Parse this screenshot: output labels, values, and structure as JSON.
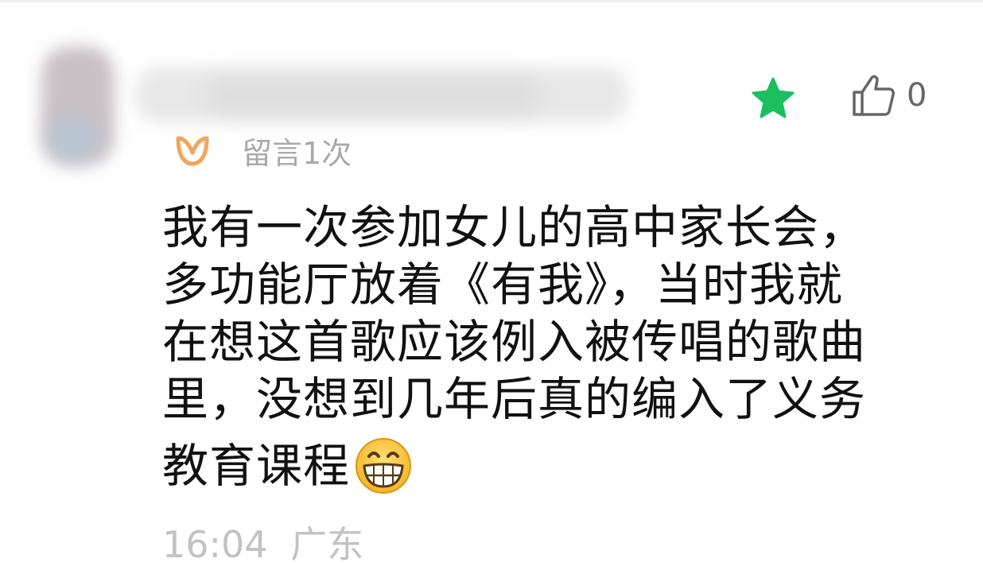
{
  "comment": {
    "message_count": "留言1次",
    "like_count": "0",
    "text_lines": [
      "我有一次参加女儿的高中家长会，",
      "多功能厅放着《有我》，当时我就",
      "在想这首歌应该例入被传唱的歌曲",
      "里，没想到几年后真的编入了义务",
      "教育课程"
    ],
    "time": "16:04",
    "location": "广东"
  },
  "icons": {
    "badge": "badge-icon",
    "star": "star-icon",
    "like": "thumbs-up-icon",
    "emoji": "grinning-emoji"
  },
  "colors": {
    "star": "#1bbf5e",
    "badge": "#f2a45c",
    "muted_text": "#a9a9a9"
  }
}
